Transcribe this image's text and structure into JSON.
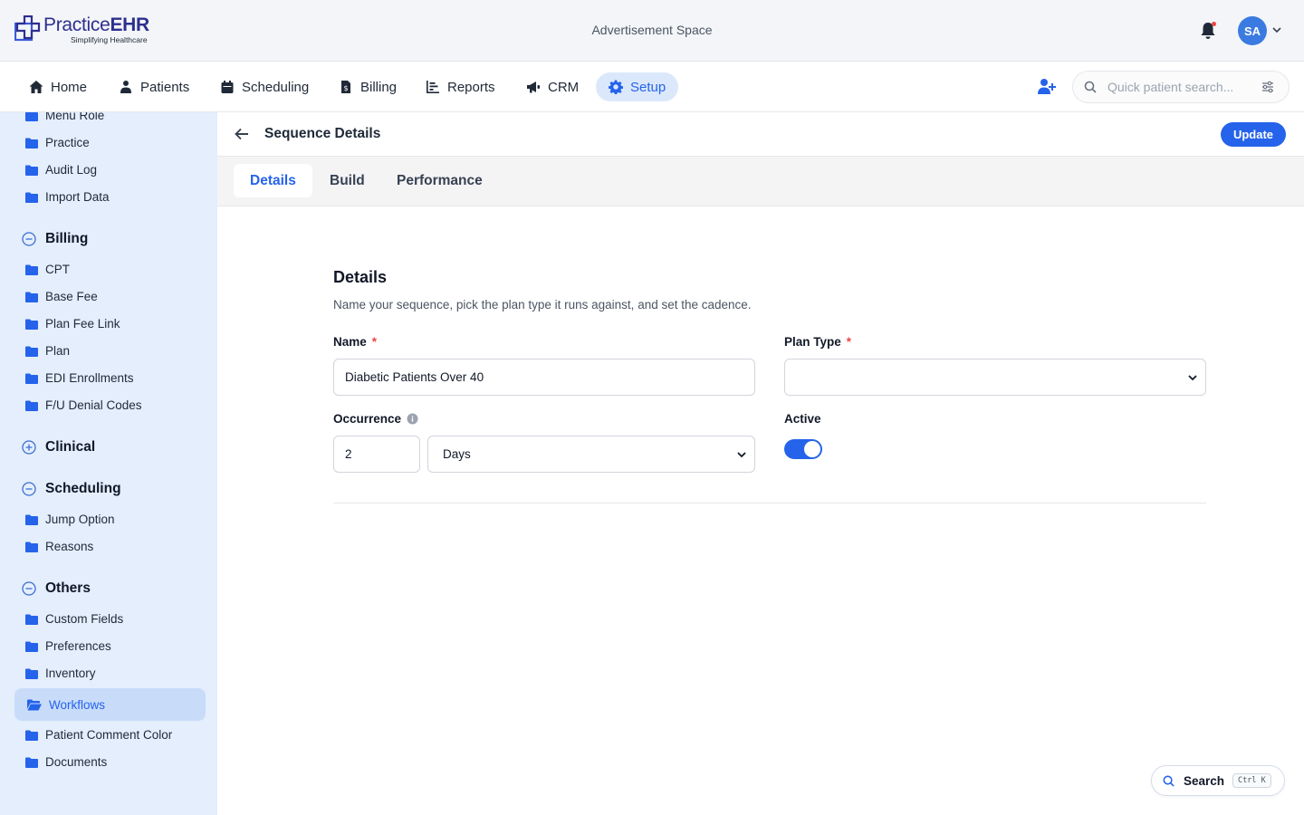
{
  "header": {
    "logo_name_light": "Practice",
    "logo_name_bold": "EHR",
    "logo_tagline": "Simplifying Healthcare",
    "ad_text": "Advertisement Space",
    "avatar_initials": "SA"
  },
  "nav": {
    "items": [
      {
        "label": "Home",
        "icon": "home-icon"
      },
      {
        "label": "Patients",
        "icon": "patients-icon"
      },
      {
        "label": "Scheduling",
        "icon": "calendar-icon"
      },
      {
        "label": "Billing",
        "icon": "billing-icon"
      },
      {
        "label": "Reports",
        "icon": "reports-icon"
      },
      {
        "label": "CRM",
        "icon": "megaphone-icon"
      },
      {
        "label": "Setup",
        "icon": "gear-icon",
        "active": true
      }
    ],
    "search_placeholder": "Quick patient search..."
  },
  "sidebar": {
    "top_items": [
      "Menu Role",
      "Practice",
      "Audit Log",
      "Import Data"
    ],
    "sections": [
      {
        "title": "Billing",
        "expanded": true,
        "items": [
          "CPT",
          "Base Fee",
          "Plan Fee Link",
          "Plan",
          "EDI Enrollments",
          "F/U Denial Codes"
        ]
      },
      {
        "title": "Clinical",
        "expanded": false,
        "items": []
      },
      {
        "title": "Scheduling",
        "expanded": true,
        "items": [
          "Jump Option",
          "Reasons"
        ]
      },
      {
        "title": "Others",
        "expanded": true,
        "items": [
          "Custom Fields",
          "Preferences",
          "Inventory",
          "Workflows",
          "Patient Comment Color",
          "Documents"
        ]
      }
    ],
    "active_item": "Workflows"
  },
  "page": {
    "title": "Sequence Details",
    "update_label": "Update",
    "tabs": [
      "Details",
      "Build",
      "Performance"
    ],
    "active_tab": "Details"
  },
  "form": {
    "section_title": "Details",
    "section_desc": "Name your sequence, pick the plan type it runs against, and set the cadence.",
    "name_label": "Name",
    "name_value": "Diabetic Patients Over 40",
    "plan_type_label": "Plan Type",
    "plan_type_value": "",
    "occurrence_label": "Occurrence",
    "occurrence_value": "2",
    "occurrence_unit": "Days",
    "active_label": "Active",
    "active": true,
    "required_mark": "*"
  },
  "search_fab": {
    "label": "Search",
    "shortcut": "Ctrl K"
  },
  "colors": {
    "accent": "#2563eb",
    "sidebar_bg": "#e4eefc",
    "sidebar_active": "#c8dcfa",
    "required": "#ef4444"
  }
}
